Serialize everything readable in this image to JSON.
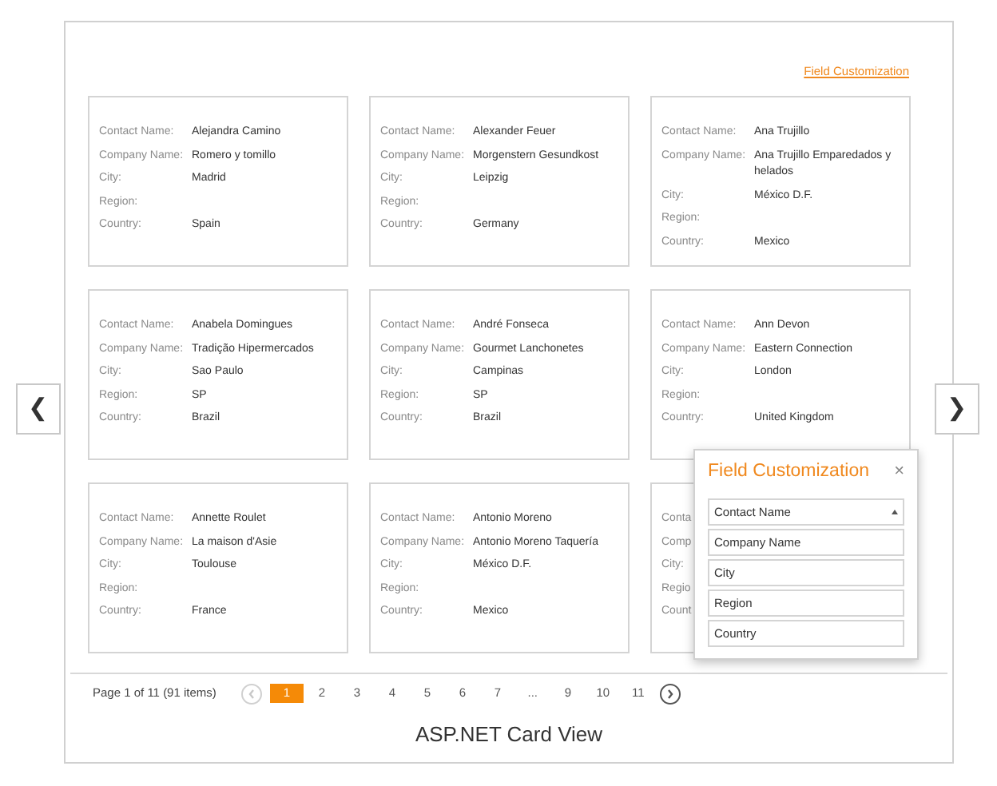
{
  "nav": {
    "prev_button": "❮",
    "next_button": "❯"
  },
  "field_customization_link": "Field Customization",
  "cards": [
    {
      "fields": [
        {
          "label": "Contact Name:",
          "value": "Alejandra Camino"
        },
        {
          "label": "Company Name:",
          "value": "Romero y tomillo"
        },
        {
          "label": "City:",
          "value": "Madrid"
        },
        {
          "label": "Region:"
        },
        {
          "label": "Country:",
          "value": "Spain"
        }
      ]
    },
    {
      "fields": [
        {
          "label": "Contact Name:",
          "value": "Alexander Feuer"
        },
        {
          "label": "Company Name:",
          "value": "Morgenstern Gesundkost"
        },
        {
          "label": "City:",
          "value": "Leipzig"
        },
        {
          "label": "Region:"
        },
        {
          "label": "Country:",
          "value": "Germany"
        }
      ]
    },
    {
      "fields": [
        {
          "label": "Contact Name:",
          "value": "Ana Trujillo"
        },
        {
          "label": "Company Name:",
          "value": "Ana Trujillo Emparedados y helados"
        },
        {
          "label": "City:",
          "value": "México D.F."
        },
        {
          "label": "Region:"
        },
        {
          "label": "Country:",
          "value": "Mexico"
        }
      ]
    },
    {
      "fields": [
        {
          "label": "Contact Name:",
          "value": "Anabela Domingues"
        },
        {
          "label": "Company Name:",
          "value": "Tradição Hipermercados"
        },
        {
          "label": "City:",
          "value": "Sao Paulo"
        },
        {
          "label": "Region:",
          "value": "SP"
        },
        {
          "label": "Country:",
          "value": "Brazil"
        }
      ]
    },
    {
      "fields": [
        {
          "label": "Contact Name:",
          "value": "André Fonseca"
        },
        {
          "label": "Company Name:",
          "value": "Gourmet Lanchonetes"
        },
        {
          "label": "City:",
          "value": "Campinas"
        },
        {
          "label": "Region:",
          "value": "SP"
        },
        {
          "label": "Country:",
          "value": "Brazil"
        }
      ]
    },
    {
      "fields": [
        {
          "label": "Contact Name:",
          "value": "Ann Devon"
        },
        {
          "label": "Company Name:",
          "value": "Eastern Connection"
        },
        {
          "label": "City:",
          "value": "London"
        },
        {
          "label": "Region:"
        },
        {
          "label": "Country:",
          "value": "United Kingdom"
        }
      ]
    },
    {
      "fields": [
        {
          "label": "Contact Name:",
          "value": "Annette Roulet"
        },
        {
          "label": "Company Name:",
          "value": "La maison d'Asie"
        },
        {
          "label": "City:",
          "value": "Toulouse"
        },
        {
          "label": "Region:"
        },
        {
          "label": "Country:",
          "value": "France"
        }
      ]
    },
    {
      "fields": [
        {
          "label": "Contact Name:",
          "value": "Antonio Moreno"
        },
        {
          "label": "Company Name:",
          "value": "Antonio Moreno Taquería"
        },
        {
          "label": "City:",
          "value": "México D.F."
        },
        {
          "label": "Region:"
        },
        {
          "label": "Country:",
          "value": "Mexico"
        }
      ]
    },
    {
      "fields": [
        {
          "label": "Conta"
        },
        {
          "label": "Comp"
        },
        {
          "label": "City:"
        },
        {
          "label": "Regio"
        },
        {
          "label": "Count"
        }
      ]
    }
  ],
  "pager": {
    "summary": "Page 1 of 11 (91 items)",
    "prev_disabled": true,
    "next_disabled": false,
    "pages": [
      {
        "label": "1",
        "selected": true
      },
      {
        "label": "2",
        "selected": false
      },
      {
        "label": "3",
        "selected": false
      },
      {
        "label": "4",
        "selected": false
      },
      {
        "label": "5",
        "selected": false
      },
      {
        "label": "6",
        "selected": false
      },
      {
        "label": "7",
        "selected": false
      },
      {
        "label": "...",
        "selected": false
      },
      {
        "label": "9",
        "selected": false
      },
      {
        "label": "10",
        "selected": false
      },
      {
        "label": "11",
        "selected": false
      }
    ]
  },
  "caption": "ASP.NET Card View",
  "popup": {
    "title": "Field Customization",
    "close": "×",
    "fields": [
      {
        "label": "Contact Name",
        "sorted": true
      },
      {
        "label": "Company Name",
        "sorted": false
      },
      {
        "label": "City",
        "sorted": false
      },
      {
        "label": "Region",
        "sorted": false
      },
      {
        "label": "Country",
        "sorted": false
      }
    ]
  }
}
